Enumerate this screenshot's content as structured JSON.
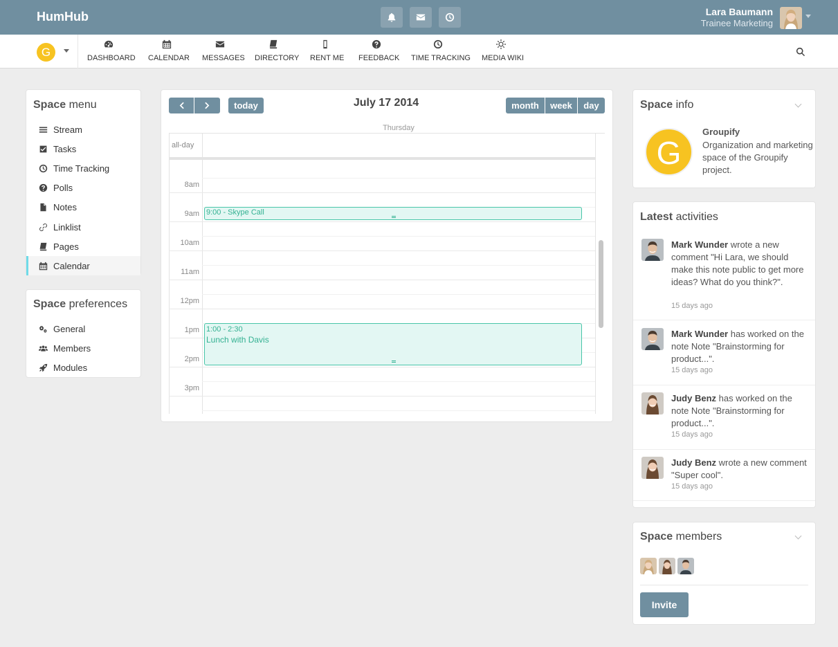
{
  "app": {
    "brand": "HumHub"
  },
  "user": {
    "name": "Lara Baumann",
    "title": "Trainee Marketing"
  },
  "space": {
    "logo_letter": "G"
  },
  "nav": [
    {
      "label": "DASHBOARD",
      "icon": "dashboard-icon"
    },
    {
      "label": "CALENDAR",
      "icon": "calendar-icon"
    },
    {
      "label": "MESSAGES",
      "icon": "envelope-icon"
    },
    {
      "label": "DIRECTORY",
      "icon": "book-icon"
    },
    {
      "label": "RENT ME",
      "icon": "mobile-icon"
    },
    {
      "label": "FEEDBACK",
      "icon": "question-icon"
    },
    {
      "label": "TIME TRACKING",
      "icon": "clock-icon"
    },
    {
      "label": "MEDIA WIKI",
      "icon": "sun-icon"
    }
  ],
  "space_menu": {
    "heading_bold": "Space",
    "heading_rest": " menu",
    "items": [
      {
        "label": "Stream",
        "icon": "bars-icon"
      },
      {
        "label": "Tasks",
        "icon": "check-square-icon"
      },
      {
        "label": "Time Tracking",
        "icon": "clock-icon"
      },
      {
        "label": "Polls",
        "icon": "question-circle-icon"
      },
      {
        "label": "Notes",
        "icon": "file-icon"
      },
      {
        "label": "Linklist",
        "icon": "link-icon"
      },
      {
        "label": "Pages",
        "icon": "book-icon"
      },
      {
        "label": "Calendar",
        "icon": "calendar-icon"
      }
    ]
  },
  "space_prefs": {
    "heading_bold": "Space",
    "heading_rest": " preferences",
    "items": [
      {
        "label": "General",
        "icon": "cogs-icon"
      },
      {
        "label": "Members",
        "icon": "users-icon"
      },
      {
        "label": "Modules",
        "icon": "rocket-icon"
      }
    ]
  },
  "calendar": {
    "today_label": "today",
    "title": "July 17 2014",
    "views": [
      "month",
      "week",
      "day"
    ],
    "day_header": "Thursday",
    "allday_label": "all-day",
    "hours": [
      "8am",
      "9am",
      "10am",
      "11am",
      "12pm",
      "1pm",
      "2pm",
      "3pm"
    ],
    "events": [
      {
        "time": "9:00",
        "title": "Skype Call",
        "label": "9:00 - Skype Call"
      },
      {
        "time": "1:00 - 2:30",
        "title": "Lunch with Davis"
      }
    ]
  },
  "space_info": {
    "heading_bold": "Space",
    "heading_rest": " info",
    "name": "Groupify",
    "description": "Organization and marketing space of the Groupify project.",
    "logo_letter": "G"
  },
  "activities": {
    "heading_bold": "Latest",
    "heading_rest": " activities",
    "items": [
      {
        "user": "Mark Wunder",
        "text": " wrote a new comment \"Hi Lara, we should make this note public to get more ideas? What do you think?\".",
        "time": "15 days ago"
      },
      {
        "user": "Mark Wunder",
        "text": " has worked on the note Note \"Brainstorming for product...\".",
        "time": "15 days ago"
      },
      {
        "user": "Judy Benz",
        "text": " has worked on the note Note \"Brainstorming for product...\".",
        "time": "15 days ago"
      },
      {
        "user": "Judy Benz",
        "text": " wrote a new comment \"Super cool\".",
        "time": "15 days ago"
      }
    ]
  },
  "members": {
    "heading_bold": "Space",
    "heading_rest": " members",
    "invite_label": "Invite"
  },
  "colors": {
    "header": "#708fa0",
    "accent": "#6fdbe8",
    "event": "#48c5a8",
    "logo": "#f7c321"
  }
}
